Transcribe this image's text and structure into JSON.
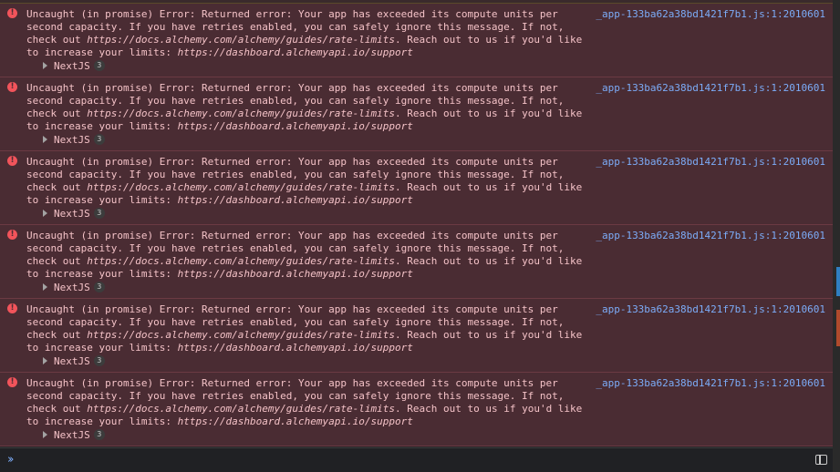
{
  "console": {
    "messages": [
      {
        "text_before_docs": "Uncaught (in promise) Error: Returned error: Your app has exceeded its compute units per second capacity. If you have retries enabled, you can safely ignore this message. If not, check out ",
        "docs_url": "https://docs.alchemy.com/alchemy/guides/rate-limits",
        "text_between": ". Reach out to us if you'd like to increase your limits: ",
        "support_url": "https://dashboard.alchemyapi.io/support",
        "source": "_app-133ba62a38bd1421f7b1.js:1:2010601",
        "stack_label": "NextJS",
        "count": "3"
      },
      {
        "text_before_docs": "Uncaught (in promise) Error: Returned error: Your app has exceeded its compute units per second capacity. If you have retries enabled, you can safely ignore this message. If not, check out ",
        "docs_url": "https://docs.alchemy.com/alchemy/guides/rate-limits",
        "text_between": ". Reach out to us if you'd like to increase your limits: ",
        "support_url": "https://dashboard.alchemyapi.io/support",
        "source": "_app-133ba62a38bd1421f7b1.js:1:2010601",
        "stack_label": "NextJS",
        "count": "3"
      },
      {
        "text_before_docs": "Uncaught (in promise) Error: Returned error: Your app has exceeded its compute units per second capacity. If you have retries enabled, you can safely ignore this message. If not, check out ",
        "docs_url": "https://docs.alchemy.com/alchemy/guides/rate-limits",
        "text_between": ". Reach out to us if you'd like to increase your limits: ",
        "support_url": "https://dashboard.alchemyapi.io/support",
        "source": "_app-133ba62a38bd1421f7b1.js:1:2010601",
        "stack_label": "NextJS",
        "count": "3"
      },
      {
        "text_before_docs": "Uncaught (in promise) Error: Returned error: Your app has exceeded its compute units per second capacity. If you have retries enabled, you can safely ignore this message. If not, check out ",
        "docs_url": "https://docs.alchemy.com/alchemy/guides/rate-limits",
        "text_between": ". Reach out to us if you'd like to increase your limits: ",
        "support_url": "https://dashboard.alchemyapi.io/support",
        "source": "_app-133ba62a38bd1421f7b1.js:1:2010601",
        "stack_label": "NextJS",
        "count": "3"
      },
      {
        "text_before_docs": "Uncaught (in promise) Error: Returned error: Your app has exceeded its compute units per second capacity. If you have retries enabled, you can safely ignore this message. If not, check out ",
        "docs_url": "https://docs.alchemy.com/alchemy/guides/rate-limits",
        "text_between": ". Reach out to us if you'd like to increase your limits: ",
        "support_url": "https://dashboard.alchemyapi.io/support",
        "source": "_app-133ba62a38bd1421f7b1.js:1:2010601",
        "stack_label": "NextJS",
        "count": "3"
      },
      {
        "text_before_docs": "Uncaught (in promise) Error: Returned error: Your app has exceeded its compute units per second capacity. If you have retries enabled, you can safely ignore this message. If not, check out ",
        "docs_url": "https://docs.alchemy.com/alchemy/guides/rate-limits",
        "text_between": ". Reach out to us if you'd like to increase your limits: ",
        "support_url": "https://dashboard.alchemyapi.io/support",
        "source": "_app-133ba62a38bd1421f7b1.js:1:2010601",
        "stack_label": "NextJS",
        "count": "3"
      }
    ],
    "icons": {
      "error": "error-icon",
      "expand": "expand-triangle-icon",
      "prompt": "prompt-chevron-icon",
      "sidebar": "sidebar-toggle-icon"
    },
    "colors": {
      "error_background": "#4a2c33",
      "error_text": "#f4c2c7",
      "error_icon": "#f2545b",
      "link": "#7cacf8",
      "console_background": "#202124"
    }
  }
}
